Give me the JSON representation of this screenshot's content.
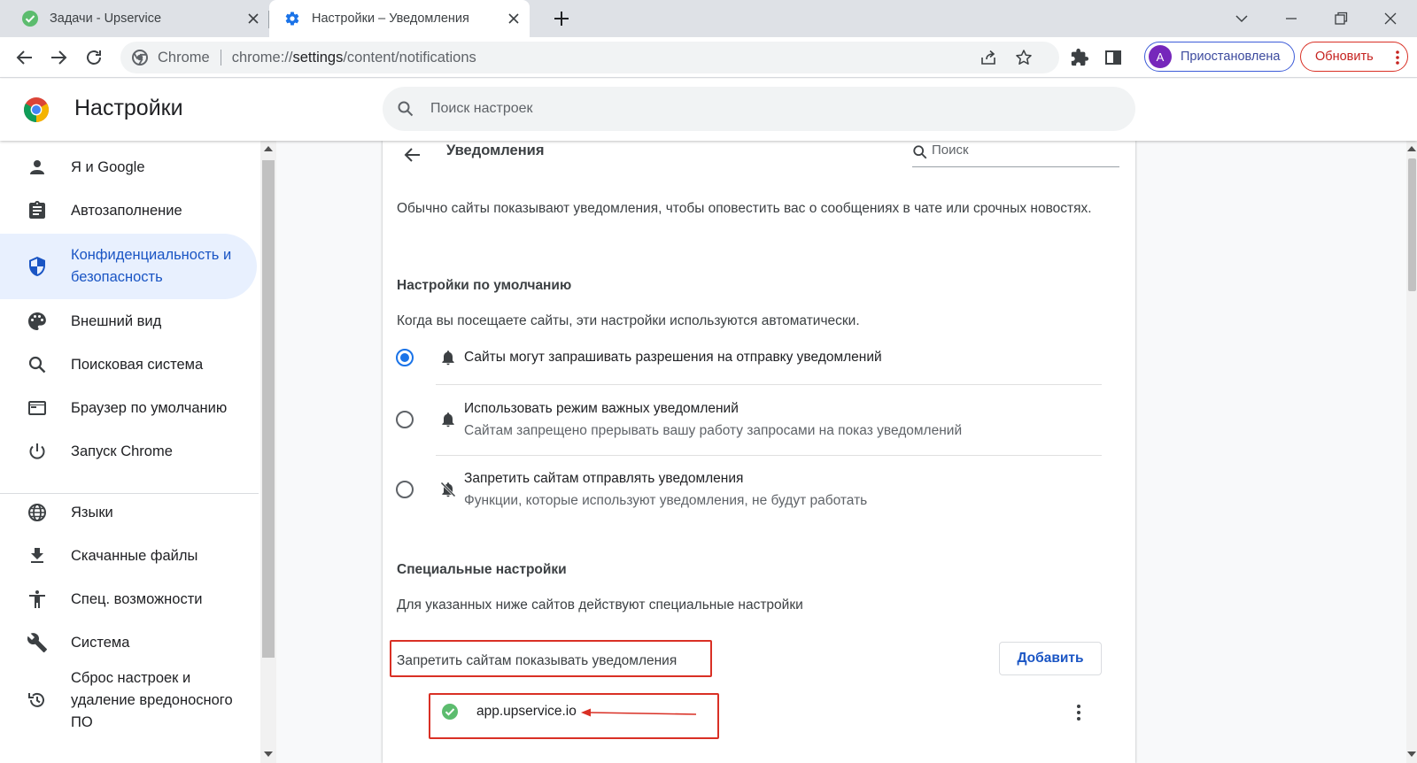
{
  "tabs": [
    {
      "title": "Задачи - Upservice",
      "active": false
    },
    {
      "title": "Настройки – Уведомления",
      "active": true
    }
  ],
  "omnibox": {
    "site_label": "Chrome",
    "url_scheme": "chrome://",
    "url_host": "settings",
    "url_path": "/content/notifications"
  },
  "profile": {
    "initial": "A",
    "status": "Приостановлена"
  },
  "update_label": "Обновить",
  "header": {
    "title": "Настройки",
    "search_placeholder": "Поиск настроек"
  },
  "sidebar": {
    "items": [
      {
        "label": "Я и Google",
        "icon": "person-icon"
      },
      {
        "label": "Автозаполнение",
        "icon": "clipboard-icon"
      },
      {
        "label": "Конфиденциальность и безопасность",
        "icon": "shield-icon",
        "active": true
      },
      {
        "label": "Внешний вид",
        "icon": "palette-icon"
      },
      {
        "label": "Поисковая система",
        "icon": "search-icon"
      },
      {
        "label": "Браузер по умолчанию",
        "icon": "browser-window-icon"
      },
      {
        "label": "Запуск Chrome",
        "icon": "power-icon"
      },
      {
        "label": "Языки",
        "icon": "globe-icon"
      },
      {
        "label": "Скачанные файлы",
        "icon": "download-icon"
      },
      {
        "label": "Спец. возможности",
        "icon": "accessibility-icon"
      },
      {
        "label": "Система",
        "icon": "wrench-icon"
      },
      {
        "label": "Сброс настроек и удаление вредоносного ПО",
        "icon": "restore-icon"
      }
    ]
  },
  "page": {
    "title": "Уведомления",
    "search_placeholder": "Поиск",
    "description": "Обычно сайты показывают уведомления, чтобы оповестить вас о сообщениях в чате или срочных новостях.",
    "default_section": {
      "heading": "Настройки по умолчанию",
      "subtitle": "Когда вы посещаете сайты, эти настройки используются автоматически.",
      "options": [
        {
          "label": "Сайты могут запрашивать разрешения на отправку уведомлений",
          "sublabel": "",
          "selected": true,
          "icon": "bell-icon"
        },
        {
          "label": "Использовать режим важных уведомлений",
          "sublabel": "Сайтам запрещено прерывать вашу работу запросами на показ уведомлений",
          "selected": false,
          "icon": "bell-icon"
        },
        {
          "label": "Запретить сайтам отправлять уведомления",
          "sublabel": "Функции, которые используют уведомления, не будут работать",
          "selected": false,
          "icon": "bell-off-icon"
        }
      ]
    },
    "custom_section": {
      "heading": "Специальные настройки",
      "subtitle": "Для указанных ниже сайтов действуют специальные настройки",
      "block_label": "Запретить сайтам показывать уведомления",
      "add_label": "Добавить",
      "sites": [
        {
          "name": "app.upservice.io",
          "icon": "check-circle-icon"
        }
      ]
    }
  },
  "colors": {
    "accent": "#1a73e8",
    "annotation": "#d93025",
    "profile": "#7627bb"
  }
}
